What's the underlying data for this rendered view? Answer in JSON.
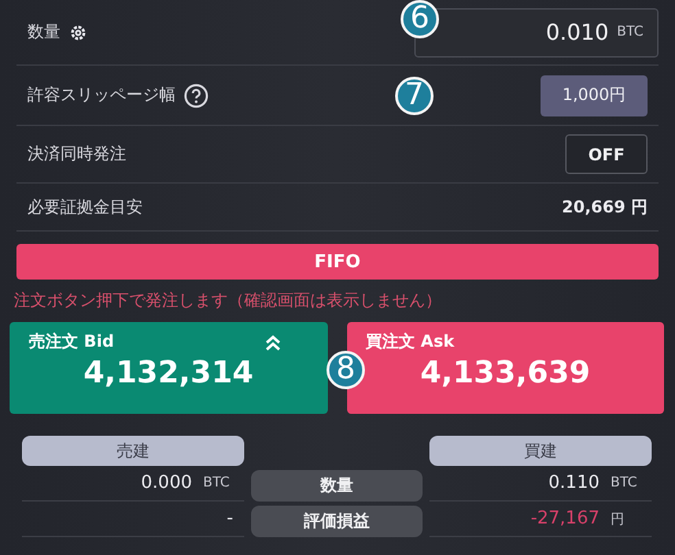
{
  "quantity": {
    "label": "数量",
    "value": "0.010",
    "unit": "BTC",
    "callout": "6"
  },
  "slippage": {
    "label": "許容スリッページ幅",
    "value": "1,000円",
    "callout": "7"
  },
  "simultaneous_settlement": {
    "label": "決済同時発注",
    "value": "OFF"
  },
  "required_margin": {
    "label": "必要証拠金目安",
    "value": "20,669 円"
  },
  "fifo_button": "FIFO",
  "notice": "注文ボタン押下で発注します（確認画面は表示しません）",
  "orders": {
    "callout": "8",
    "buttons": [
      {
        "kind": "sell",
        "label": "売注文 Bid",
        "price": "4,132,314"
      },
      {
        "kind": "buy",
        "label": "買注文 Ask",
        "price": "4,133,639"
      }
    ]
  },
  "positions": {
    "headers": [
      "売建",
      "買建"
    ],
    "rows": [
      {
        "label": "数量",
        "sell": {
          "value": "0.000",
          "unit": "BTC",
          "negative": false
        },
        "buy": {
          "value": "0.110",
          "unit": "BTC",
          "negative": false
        }
      },
      {
        "label": "評価損益",
        "sell": {
          "value": "-",
          "negative": false
        },
        "buy": {
          "value": "-27,167",
          "unit": "円",
          "negative": true
        }
      }
    ]
  }
}
